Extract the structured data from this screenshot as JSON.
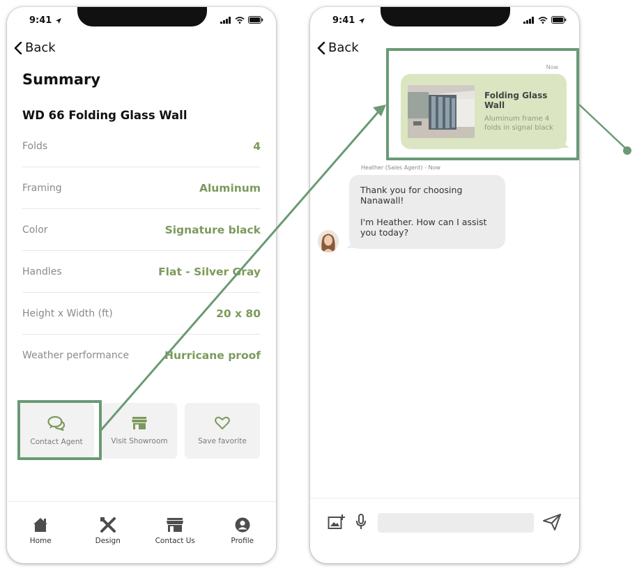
{
  "status": {
    "time": "9:41"
  },
  "left": {
    "back_label": "Back",
    "title": "Summary",
    "product_name": "WD 66 Folding Glass Wall",
    "specs": [
      {
        "label": "Folds",
        "value": "4"
      },
      {
        "label": "Framing",
        "value": "Aluminum"
      },
      {
        "label": "Color",
        "value": "Signature black"
      },
      {
        "label": "Handles",
        "value": "Flat - Silver Gray"
      },
      {
        "label": "Height x Width (ft)",
        "value": "20 x 80"
      },
      {
        "label": "Weather performance",
        "value": "Hurricane proof"
      }
    ],
    "actions": [
      {
        "label": "Contact Agent",
        "icon": "chat-bubbles-icon"
      },
      {
        "label": "Visit Showroom",
        "icon": "storefront-icon"
      },
      {
        "label": "Save favorite",
        "icon": "heart-icon"
      }
    ],
    "tabs": [
      {
        "label": "Home",
        "icon": "home-icon"
      },
      {
        "label": "Design",
        "icon": "design-tools-icon"
      },
      {
        "label": "Contact Us",
        "icon": "storefront-icon"
      },
      {
        "label": "Profile",
        "icon": "profile-icon"
      }
    ]
  },
  "right": {
    "back_label": "Back",
    "product_message": {
      "timestamp": "Now",
      "title": "Folding Glass Wall",
      "description": "Aluminum frame 4 folds in signal black"
    },
    "agent_meta": "Heather (Sales Agent) - Now",
    "agent_message": {
      "line1": "Thank you for choosing Nanawall!",
      "line2": "I'm Heather. How can I assist you today?"
    },
    "composer": {
      "placeholder": ""
    }
  },
  "colors": {
    "accent_green": "#7c9a5c",
    "highlight_green": "#6a9a74",
    "product_bubble": "#dbe5c2",
    "agent_bubble": "#ececec"
  }
}
